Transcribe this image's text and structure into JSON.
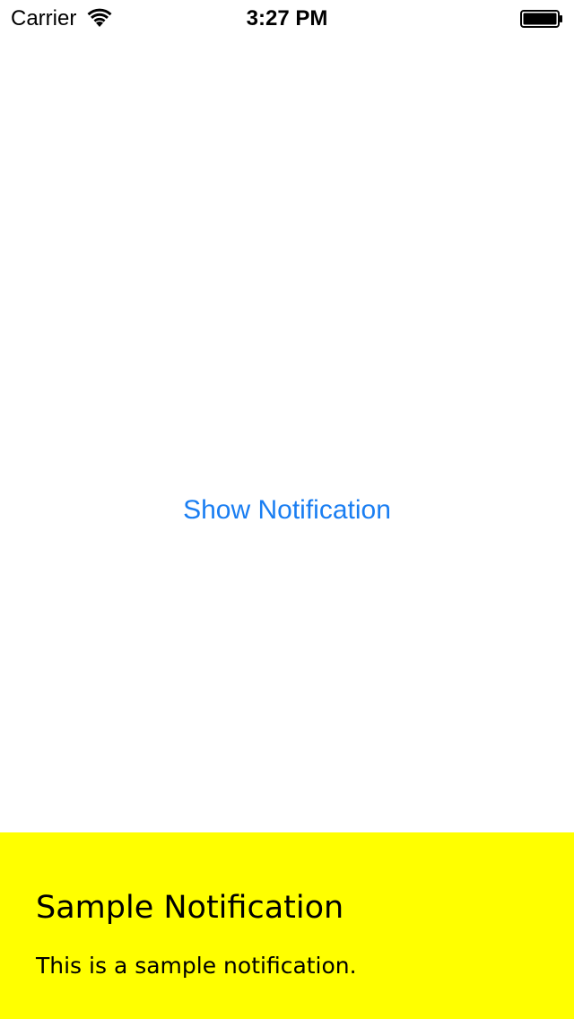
{
  "status_bar": {
    "carrier": "Carrier",
    "time": "3:27 PM",
    "wifi_icon": "wifi-icon",
    "battery_icon": "battery-icon"
  },
  "main": {
    "show_button_label": "Show Notification",
    "accent_color": "#1a7ef2"
  },
  "notification": {
    "title": "Sample Notification",
    "message": "This is a sample notification.",
    "background_color": "#ffff00"
  }
}
